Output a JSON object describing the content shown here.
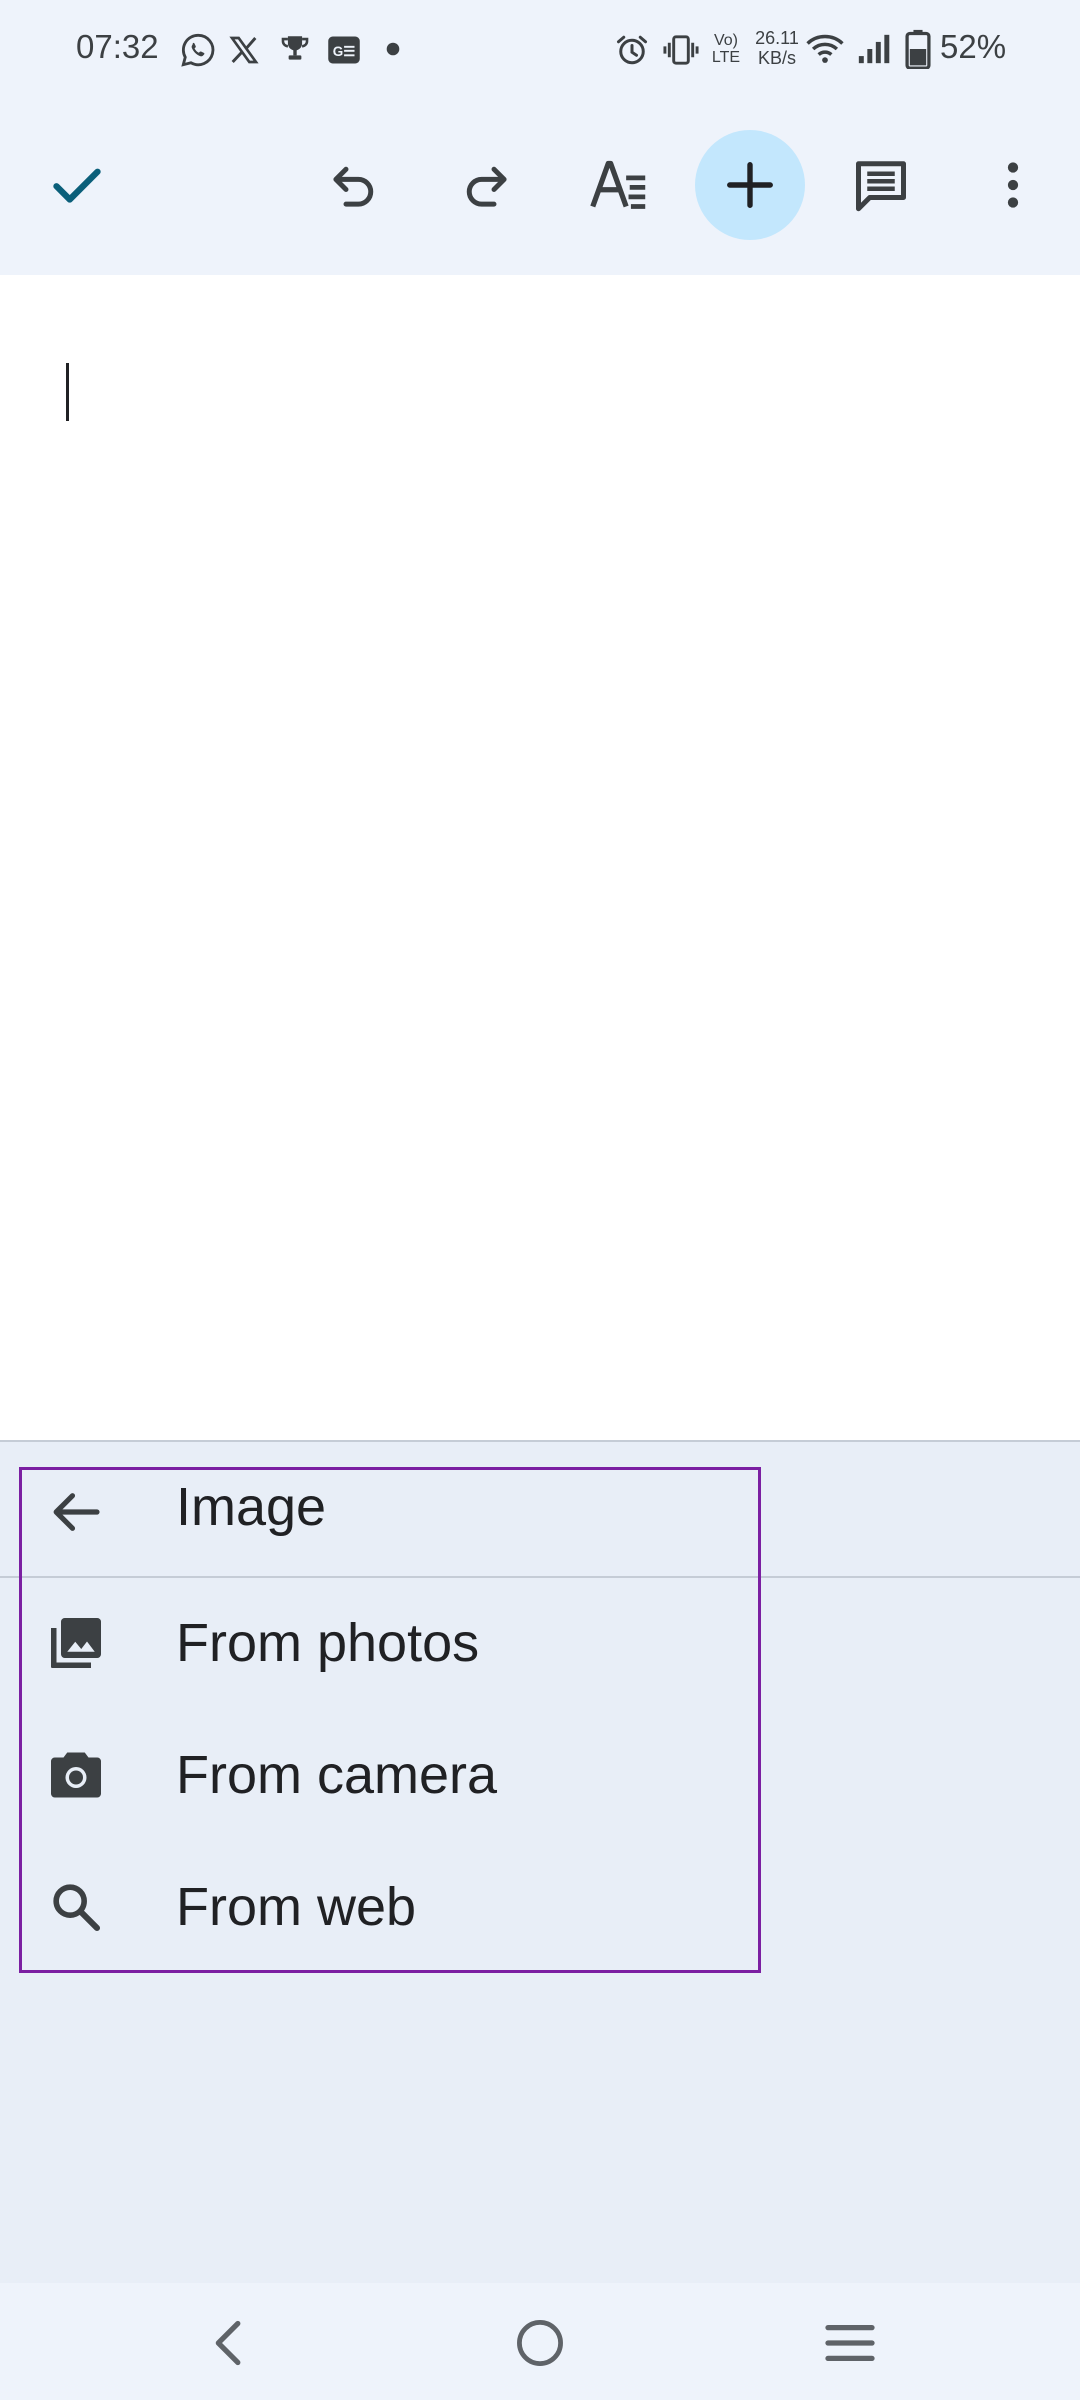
{
  "status_bar": {
    "time": "07:32",
    "network_speed_value": "26.11",
    "network_speed_unit": "KB/s",
    "volte_top": "Vo)",
    "volte_bottom": "LTE",
    "battery_percent": "52%",
    "left_icons": [
      "whatsapp-icon",
      "x-icon",
      "trophy-icon",
      "gallery-app-icon",
      "dot-icon"
    ],
    "right_icons": [
      "alarm-icon",
      "vibrate-icon",
      "volte-icon",
      "wifi-icon",
      "signal-icon",
      "battery-icon"
    ]
  },
  "toolbar": {
    "icons": [
      "check-icon",
      "undo-icon",
      "redo-icon",
      "text-format-icon",
      "insert-plus-icon",
      "comment-icon",
      "more-vert-icon"
    ],
    "accent_color": "#0b5f7a",
    "active_bg": "#c3e7fd"
  },
  "panel": {
    "title": "Image",
    "items": [
      {
        "label": "From photos",
        "icon": "photo-library-icon"
      },
      {
        "label": "From camera",
        "icon": "camera-icon"
      },
      {
        "label": "From web",
        "icon": "search-icon"
      }
    ],
    "highlight_color": "#7b1fa2"
  },
  "nav_bar": {
    "icons": [
      "nav-back-icon",
      "nav-home-icon",
      "nav-recents-icon"
    ]
  }
}
